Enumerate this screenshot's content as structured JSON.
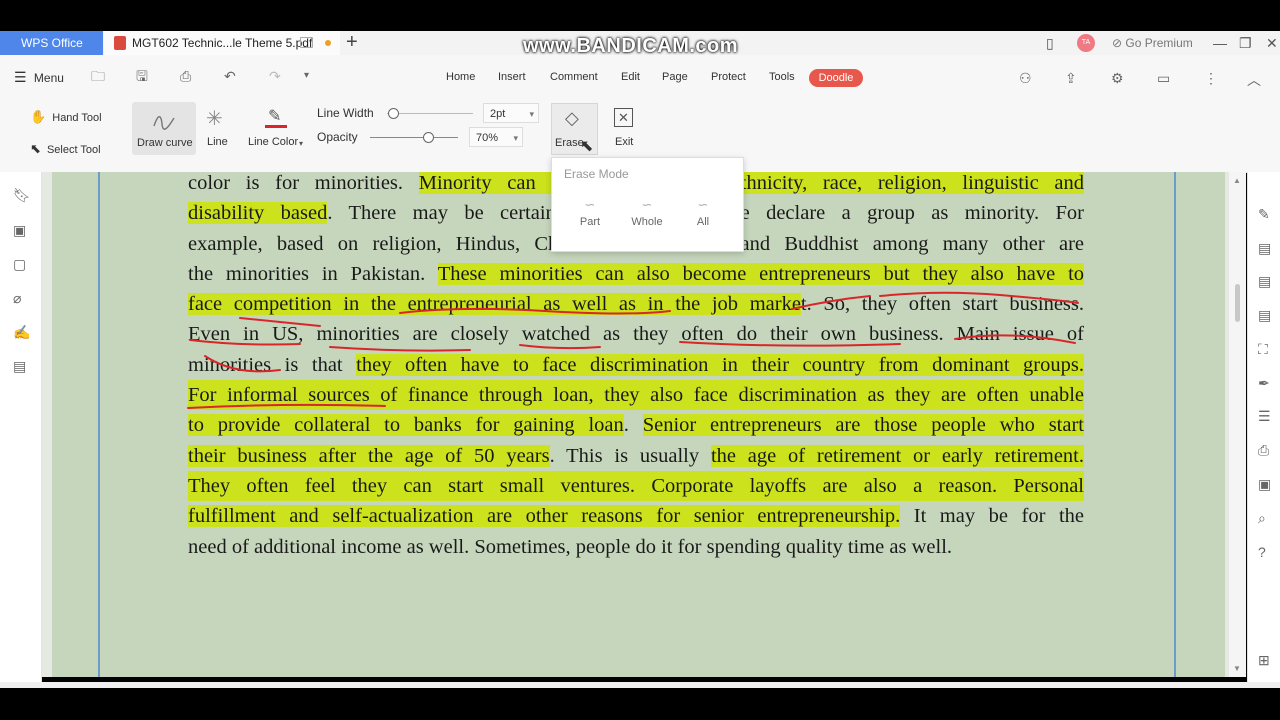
{
  "titlebar": {
    "app_tab": "WPS Office",
    "doc_tab": "MGT602 Technic...le Theme 5.pdf",
    "new_tab": "+",
    "watermark": "www.BANDICAM.com",
    "avatar": "TA",
    "premium": "Go Premium"
  },
  "menubar": {
    "menu": "Menu",
    "tabs": [
      "Home",
      "Insert",
      "Comment",
      "Edit",
      "Page",
      "Protect",
      "Tools",
      "Doodle"
    ]
  },
  "toolbar": {
    "hand_tool": "Hand Tool",
    "select_tool": "Select Tool",
    "draw_curve": "Draw curve",
    "line": "Line",
    "line_color": "Line Color",
    "line_width_label": "Line Width",
    "line_width_value": "2pt",
    "opacity_label": "Opacity",
    "opacity_value": "70%",
    "erase": "Erase",
    "exit": "Exit"
  },
  "erase_popup": {
    "title": "Erase Mode",
    "modes": [
      "Part",
      "Whole",
      "All"
    ]
  },
  "document": {
    "lines": [
      [
        "color is for minorities. ",
        "Minority can b",
        "",
        "ethnicity, race, religion, linguistic and"
      ],
      [
        "disability based",
        ". There may be certain",
        "",
        "we declare a group as minority. For"
      ],
      [
        "example, based on religion, Hindus, Ch",
        "",
        "",
        "s and Buddhist among many other are"
      ],
      [
        "the minorities in Pakistan. ",
        "These minorities can also become entrepreneurs but they also have to"
      ],
      [
        "face competition in the entrepreneurial as well as in the job marke",
        "t. So, they often start business."
      ],
      [
        "Even in US, minorities are closely watched as they often do their own business. Main issue of"
      ],
      [
        "minorities is that ",
        "they often have to face discrimination in their country from dominant groups."
      ],
      [
        "For informal sources of finance through loan, they also face discrimination as they are often unable"
      ],
      [
        "to provide collateral to banks for gaining loan",
        ". ",
        "Senior entrepreneurs are those people who start"
      ],
      [
        "their business after the age of 50 years",
        ". This is usually ",
        "the age of retirement or early retirement."
      ],
      [
        "They often feel they can start small ventures. Corporate layoffs are also a reason. Personal"
      ],
      [
        "fulfillment and self-actualization are other reasons for senior entrepreneurship.",
        " It may be for the"
      ],
      [
        "need of additional income as well. Sometimes, people do it for spending quality time as well."
      ]
    ]
  },
  "colors": {
    "accent": "#4e86ea",
    "doodle": "#e8574b",
    "highlight": "#cce21c",
    "page_bg": "#c6d6bc",
    "ink": "#d8262b"
  }
}
